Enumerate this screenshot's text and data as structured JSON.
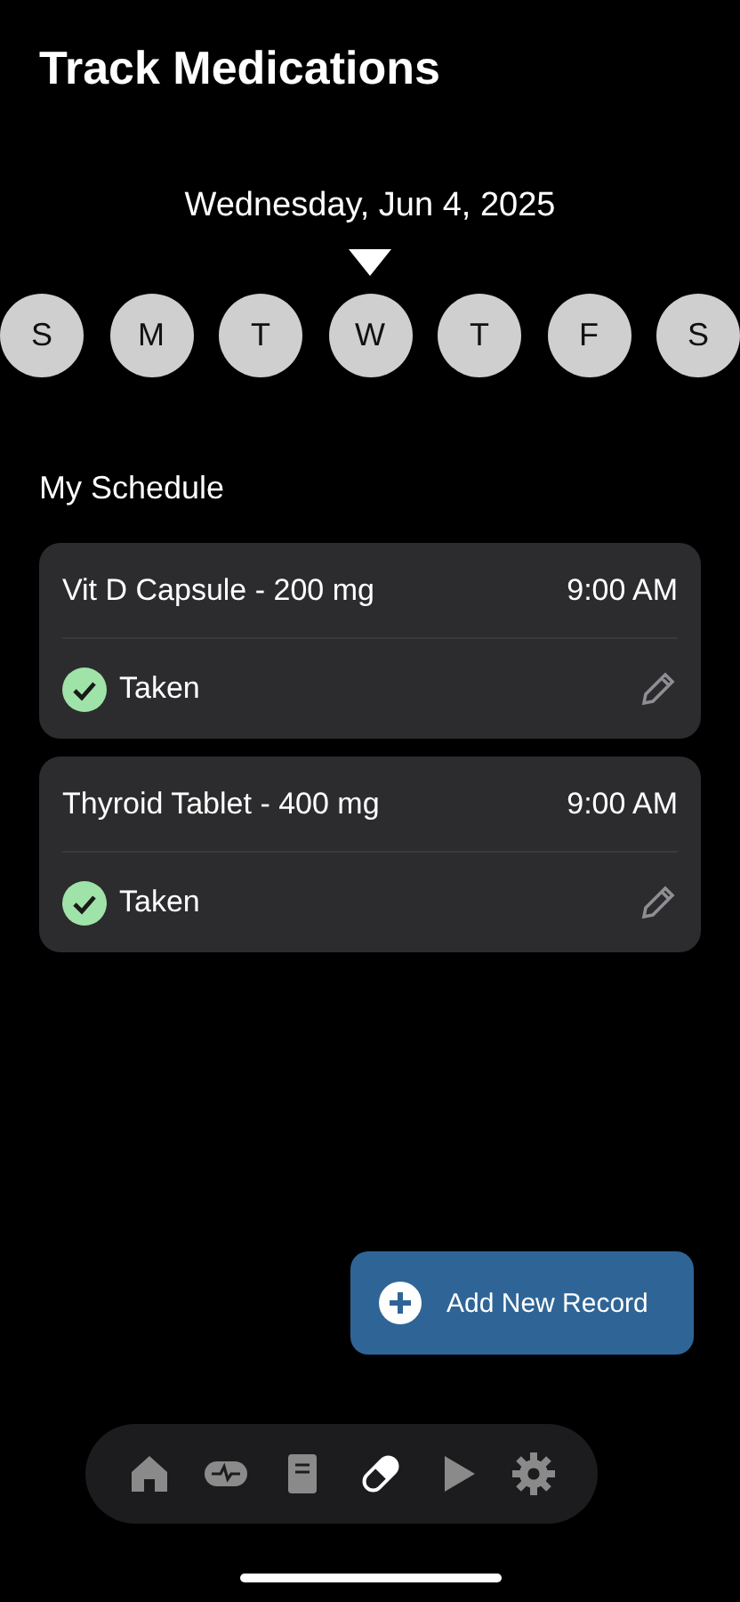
{
  "title": "Track Medications",
  "date": "Wednesday, Jun 4, 2025",
  "days": [
    {
      "label": "S",
      "selected": false
    },
    {
      "label": "M",
      "selected": false
    },
    {
      "label": "T",
      "selected": false
    },
    {
      "label": "W",
      "selected": true
    },
    {
      "label": "T",
      "selected": false
    },
    {
      "label": "F",
      "selected": false
    },
    {
      "label": "S",
      "selected": false
    }
  ],
  "section_title": "My Schedule",
  "schedule": [
    {
      "name": "Vit D Capsule - 200 mg",
      "time": "9:00 AM",
      "status": "Taken",
      "taken": true
    },
    {
      "name": "Thyroid Tablet - 400 mg",
      "time": "9:00 AM",
      "status": "Taken",
      "taken": true
    }
  ],
  "add_button": "Add New Record",
  "nav": [
    {
      "kind": "home",
      "selected": false
    },
    {
      "kind": "vitals",
      "selected": false
    },
    {
      "kind": "journal",
      "selected": false
    },
    {
      "kind": "pill",
      "selected": true
    },
    {
      "kind": "play",
      "selected": false
    },
    {
      "kind": "settings",
      "selected": false
    }
  ]
}
